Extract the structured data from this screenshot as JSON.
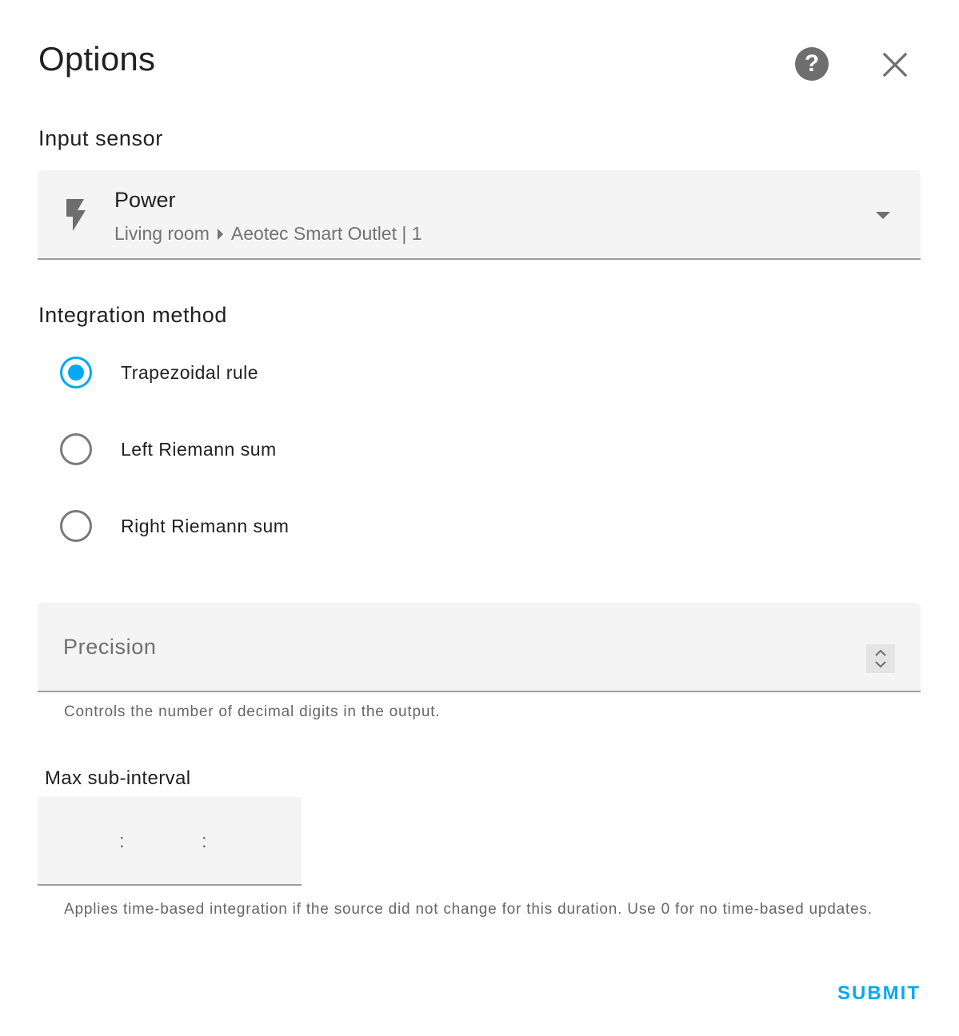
{
  "dialog": {
    "title": "Options"
  },
  "input_sensor": {
    "label": "Input sensor",
    "entity_name": "Power",
    "area": "Living room",
    "device": "Aeotec Smart Outlet | 1",
    "icon": "flash-icon"
  },
  "integration_method": {
    "label": "Integration method",
    "options": [
      {
        "label": "Trapezoidal rule",
        "checked": true
      },
      {
        "label": "Left Riemann sum",
        "checked": false
      },
      {
        "label": "Right Riemann sum",
        "checked": false
      }
    ]
  },
  "precision": {
    "placeholder": "Precision",
    "helper": "Controls the number of decimal digits in the output."
  },
  "max_sub_interval": {
    "label": "Max sub-interval",
    "separator": ":",
    "helper": "Applies time-based integration if the source did not change for this duration. Use 0 for no time-based updates."
  },
  "actions": {
    "submit_label": "SUBMIT"
  },
  "colors": {
    "accent": "#03a9f4",
    "field_background": "#f4f4f4",
    "icon_gray": "#6e6e6e"
  }
}
